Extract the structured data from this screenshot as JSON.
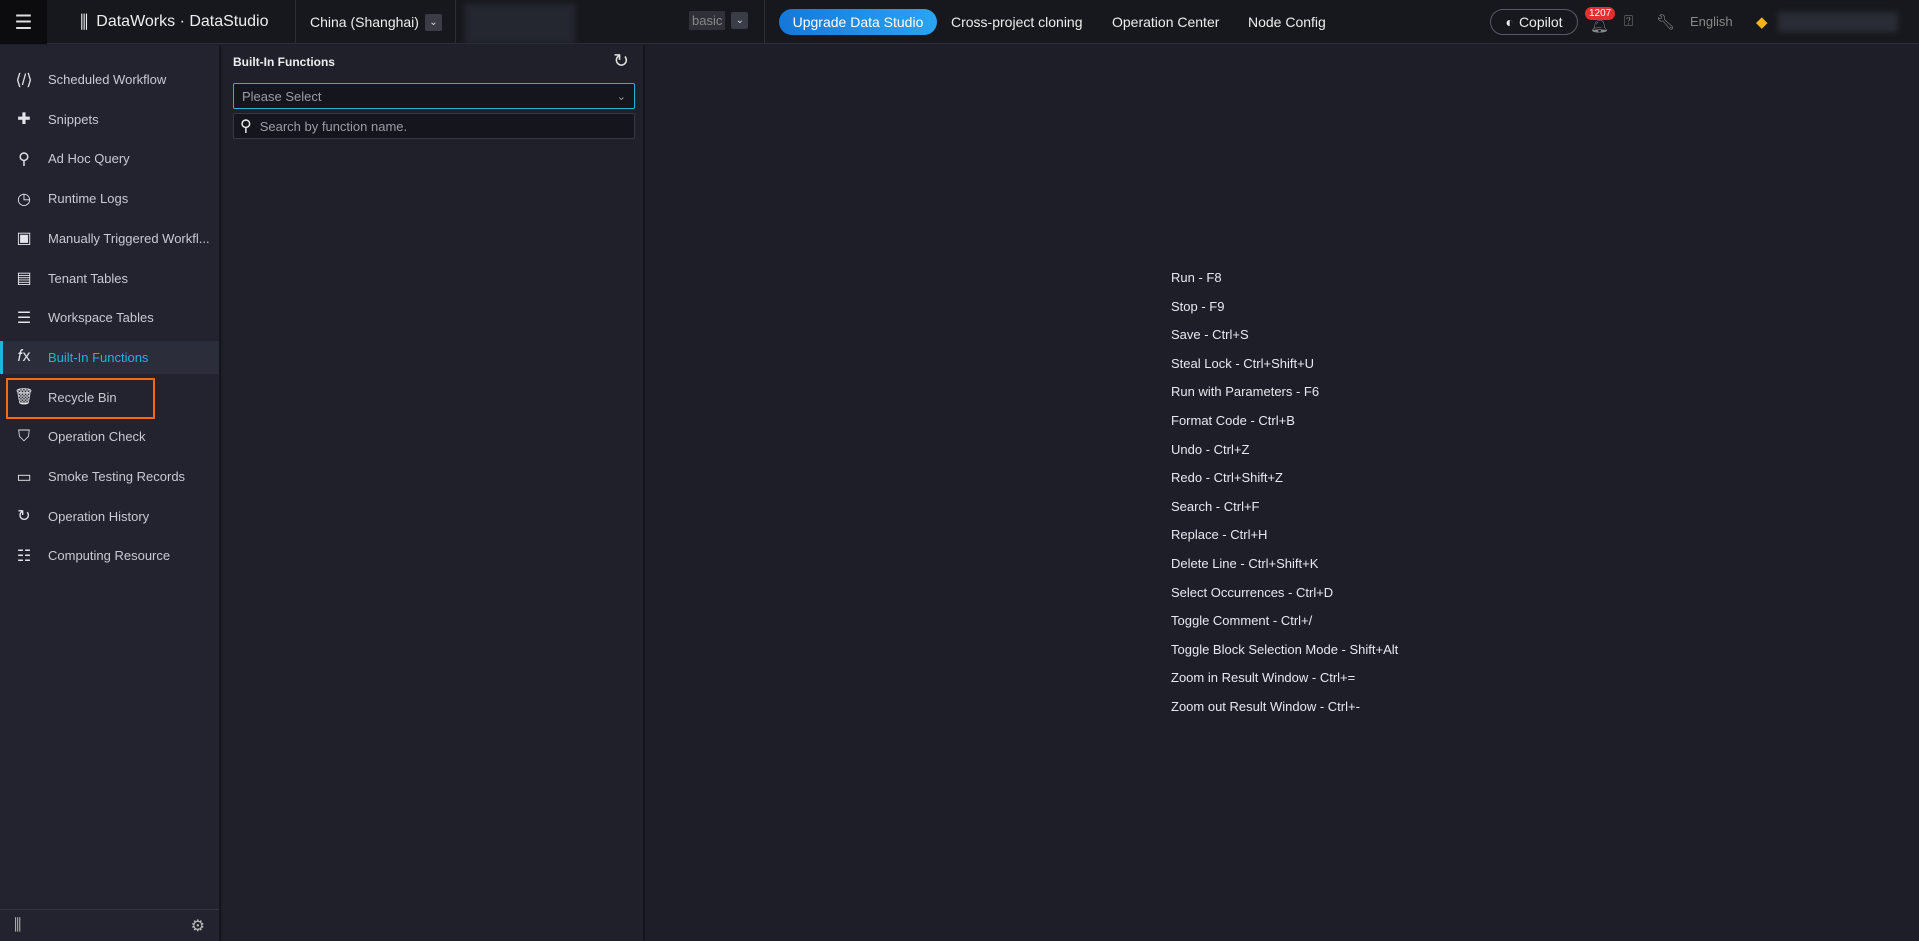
{
  "header": {
    "brand": "DataWorks · DataStudio",
    "region": "China (Shanghai)",
    "edition": "basic",
    "upgrade": "Upgrade Data Studio",
    "nav": [
      "Cross-project cloning",
      "Operation Center",
      "Node Config"
    ],
    "copilot": "Copilot",
    "notifications": "1207",
    "language": "English"
  },
  "sidebar": {
    "items": [
      {
        "label": "Scheduled Workflow",
        "icon": "code-icon"
      },
      {
        "label": "Snippets",
        "icon": "puzzle-icon"
      },
      {
        "label": "Ad Hoc Query",
        "icon": "search-icon"
      },
      {
        "label": "Runtime Logs",
        "icon": "clock-icon"
      },
      {
        "label": "Manually Triggered Workfl...",
        "icon": "briefcase-icon"
      },
      {
        "label": "Tenant Tables",
        "icon": "table-icon"
      },
      {
        "label": "Workspace Tables",
        "icon": "workspace-table-icon"
      },
      {
        "label": "Built-In Functions",
        "icon": "fx-icon",
        "active": true
      },
      {
        "label": "Recycle Bin",
        "icon": "trash-icon"
      },
      {
        "label": "Operation Check",
        "icon": "shield-check-icon"
      },
      {
        "label": "Smoke Testing Records",
        "icon": "monitor-icon"
      },
      {
        "label": "Operation History",
        "icon": "history-icon"
      },
      {
        "label": "Computing Resource",
        "icon": "database-icon"
      }
    ]
  },
  "panel": {
    "title": "Built-In Functions",
    "select_placeholder": "Please Select",
    "search_placeholder": "Search by function name."
  },
  "shortcuts": [
    "Run - F8",
    "Stop - F9",
    "Save - Ctrl+S",
    "Steal Lock - Ctrl+Shift+U",
    "Run with Parameters - F6",
    "Format Code - Ctrl+B",
    "Undo - Ctrl+Z",
    "Redo - Ctrl+Shift+Z",
    "Search - Ctrl+F",
    "Replace - Ctrl+H",
    "Delete Line - Ctrl+Shift+K",
    "Select Occurrences - Ctrl+D",
    "Toggle Comment - Ctrl+/",
    "Toggle Block Selection Mode - Shift+Alt",
    "Zoom in Result Window - Ctrl+=",
    "Zoom out Result Window - Ctrl+-"
  ],
  "colors": {
    "accent": "#1fb6d6",
    "highlight": "#f26b12",
    "upgrade": "#1677d8"
  }
}
